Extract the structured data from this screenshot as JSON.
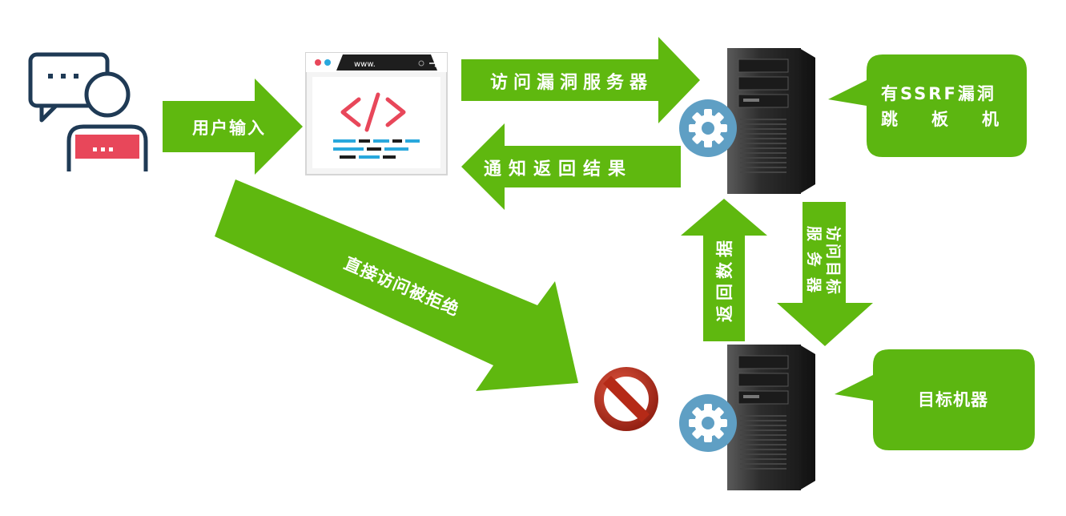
{
  "labels": {
    "user_input": "用户输入",
    "visit_vuln_server": "访问漏洞服务器",
    "notify_result": "通知返回结果",
    "direct_denied": "直接访问被拒绝",
    "return_data": "返回数据",
    "visit_target_line1": "访问目标",
    "visit_target_line2": "服务器"
  },
  "callouts": {
    "ssrf_line1": "有SSRF漏洞",
    "ssrf_line2": "跳板机",
    "target": "目标机器"
  },
  "browser": {
    "url": "www.",
    "code_symbol": "</>"
  },
  "user_icon": {
    "bubble_text": "...",
    "shirt_text": "..."
  },
  "colors": {
    "arrow_green": "#5fb80f",
    "callout_green": "#5cb611",
    "code_red": "#e8475a",
    "blue": "#29a8dd",
    "dark_navy": "#1f3a55",
    "server_dark": "#2b2b2b",
    "gear_blue": "#5f9fc4",
    "forbidden_red": "#c0392b"
  },
  "icons": [
    "user-chat-icon",
    "browser-code-icon",
    "server-icon",
    "gear-icon",
    "forbidden-icon"
  ]
}
